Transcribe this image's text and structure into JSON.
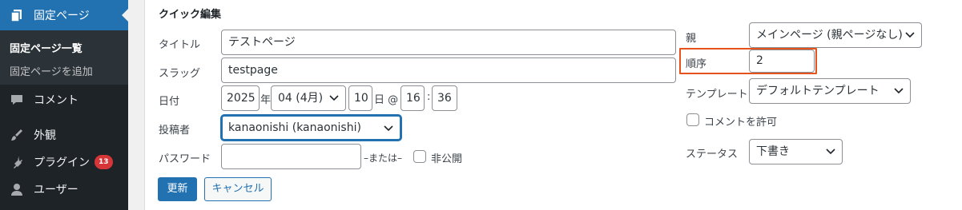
{
  "sidebar": {
    "current": {
      "label": "固定ページ",
      "icon": "pages-icon"
    },
    "submenu": {
      "current": "固定ページ一覧",
      "other": "固定ページを追加"
    },
    "items": [
      {
        "label": "コメント",
        "icon": "comment-icon"
      },
      {
        "label": "外観",
        "icon": "appearance-icon"
      },
      {
        "label": "プラグイン",
        "icon": "plugins-icon",
        "badge": "13"
      },
      {
        "label": "ユーザー",
        "icon": "users-icon"
      }
    ]
  },
  "quick_edit": {
    "title": "クイック編集",
    "title_label": "タイトル",
    "title_value": "テストページ",
    "slug_label": "スラッグ",
    "slug_value": "testpage",
    "date_label": "日付",
    "year": "2025",
    "year_suffix": "年",
    "month": "04 (4月)",
    "day": "10",
    "day_suffix": "日 @",
    "hour": "16",
    "time_sep": ":",
    "minute": "36",
    "author_label": "投稿者",
    "author_value": "kanaonishi (kanaonishi)",
    "password_label": "パスワード",
    "password_value": "",
    "or_text": "–または–",
    "private_label": "非公開",
    "private_checked": false,
    "parent_label": "親",
    "parent_value": "メインページ (親ページなし)",
    "order_label": "順序",
    "order_value": "2",
    "template_label": "テンプレート",
    "template_value": "デフォルトテンプレート",
    "allow_comments_label": "コメントを許可",
    "allow_comments_checked": false,
    "status_label": "ステータス",
    "status_value": "下書き",
    "update_button": "更新",
    "cancel_button": "キャンセル"
  },
  "colors": {
    "sidebar_bg": "#1d2327",
    "accent": "#2271b1",
    "badge": "#d63638",
    "highlight": "#e5521c"
  }
}
